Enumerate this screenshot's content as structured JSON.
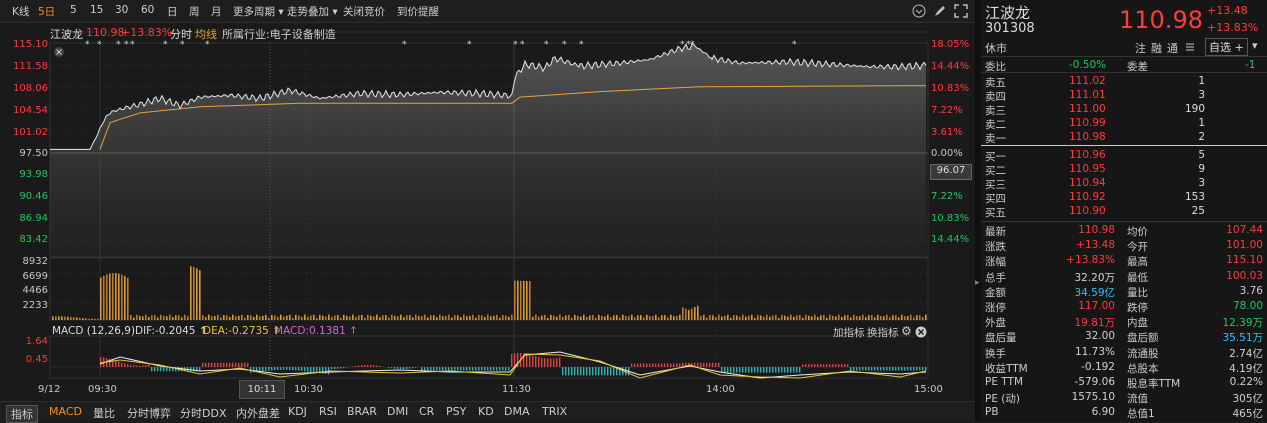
{
  "toolbar": {
    "items": [
      "K线",
      "5日",
      "5",
      "15",
      "30",
      "60",
      "日",
      "周",
      "月",
      "更多周期",
      "走势叠加",
      "关闭竞价",
      "到价提醒"
    ]
  },
  "chart": {
    "stock_name": "江波龙",
    "price": "110.98",
    "change_pct": "+13.83%",
    "tab_fenshi": "分时",
    "tab_junxian": "均线",
    "industry": "所属行业:电子设备制造",
    "left_axis": [
      "115.10",
      "111.58",
      "108.06",
      "104.54",
      "101.02",
      "97.50",
      "93.98",
      "90.46",
      "86.94",
      "83.42"
    ],
    "right_axis": [
      "18.05%",
      "14.44%",
      "10.83%",
      "7.22%",
      "3.61%",
      "0.00%",
      "7.22%",
      "10.83%",
      "14.44%"
    ],
    "cursor_value": "96.07",
    "vol_axis": [
      "8932",
      "6699",
      "4466",
      "2233"
    ],
    "macd_label": "MACD (12,26,9)",
    "dif": "DIF:-0.2045",
    "dea": "DEA:-0.2735",
    "macd": "MACD:0.1381",
    "macd_axis": [
      "1.64",
      "0.45"
    ],
    "add_indicator": "加指标",
    "switch_indicator": "换指标",
    "x_axis": [
      "9/12",
      "09:30",
      "10:30",
      "11:30",
      "14:00",
      "15:00"
    ],
    "cursor_time": "10:11",
    "colors": {
      "up": "#ff3b3b",
      "down": "#22c55e",
      "avg": "#e8a33a",
      "accent": "#ff8c1a"
    }
  },
  "tabs": [
    "指标",
    "MACD",
    "量比",
    "分时博弈",
    "分时DDX",
    "内外盘差",
    "KDJ",
    "RSI",
    "BRAR",
    "DMI",
    "CR",
    "PSY",
    "KD",
    "DMA",
    "TRIX"
  ],
  "panel": {
    "name": "江波龙",
    "code": "301308",
    "status": "休市",
    "price": "110.98",
    "change": "+13.48",
    "change_pct": "+13.83%",
    "actions": [
      "注",
      "融",
      "通"
    ],
    "watchlist": "自选 +",
    "weibi_label": "委比",
    "weibi": "-0.50%",
    "weicha_label": "委差",
    "weicha": "-1",
    "asks": [
      {
        "label": "卖五",
        "price": "111.02",
        "vol": "1"
      },
      {
        "label": "卖四",
        "price": "111.01",
        "vol": "3"
      },
      {
        "label": "卖三",
        "price": "111.00",
        "vol": "190"
      },
      {
        "label": "卖二",
        "price": "110.99",
        "vol": "1"
      },
      {
        "label": "卖一",
        "price": "110.98",
        "vol": "2"
      }
    ],
    "bids": [
      {
        "label": "买一",
        "price": "110.96",
        "vol": "5"
      },
      {
        "label": "买二",
        "price": "110.95",
        "vol": "9"
      },
      {
        "label": "买三",
        "price": "110.94",
        "vol": "3"
      },
      {
        "label": "买四",
        "price": "110.92",
        "vol": "153"
      },
      {
        "label": "买五",
        "price": "110.90",
        "vol": "25"
      }
    ],
    "stats": [
      {
        "l1": "最新",
        "v1": "110.98",
        "c1": "up",
        "l2": "均价",
        "v2": "107.44",
        "c2": "up"
      },
      {
        "l1": "涨跌",
        "v1": "+13.48",
        "c1": "up",
        "l2": "今开",
        "v2": "101.00",
        "c2": "up"
      },
      {
        "l1": "涨幅",
        "v1": "+13.83%",
        "c1": "up",
        "l2": "最高",
        "v2": "115.10",
        "c2": "up"
      },
      {
        "l1": "总手",
        "v1": "32.20万",
        "c1": "neu",
        "l2": "最低",
        "v2": "100.03",
        "c2": "up"
      },
      {
        "l1": "金额",
        "v1": "34.59亿",
        "c1": "cyan",
        "l2": "量比",
        "v2": "3.76",
        "c2": "neu"
      },
      {
        "l1": "涨停",
        "v1": "117.00",
        "c1": "up",
        "l2": "跌停",
        "v2": "78.00",
        "c2": "down"
      },
      {
        "l1": "外盘",
        "v1": "19.81万",
        "c1": "up",
        "l2": "内盘",
        "v2": "12.39万",
        "c2": "down"
      },
      {
        "l1": "盘后量",
        "v1": "32.00",
        "c1": "neu",
        "l2": "盘后额",
        "v2": "35.51万",
        "c2": "cyan"
      },
      {
        "l1": "换手",
        "v1": "11.73%",
        "c1": "neu",
        "l2": "流通股",
        "v2": "2.74亿",
        "c2": "neu"
      },
      {
        "l1": "收益TTM",
        "v1": "-0.192",
        "c1": "neu",
        "l2": "总股本",
        "v2": "4.19亿",
        "c2": "neu"
      },
      {
        "l1": "PE TTM",
        "v1": "-579.06",
        "c1": "neu",
        "l2": "股息率TTM",
        "v2": "0.22%",
        "c2": "neu"
      },
      {
        "l1": "PE (动)",
        "v1": "1575.10",
        "c1": "neu",
        "l2": "流值",
        "v2": "305亿",
        "c2": "neu"
      },
      {
        "l1": "PB",
        "v1": "6.90",
        "c1": "neu",
        "l2": "总值1",
        "v2": "465亿",
        "c2": "neu"
      }
    ]
  }
}
